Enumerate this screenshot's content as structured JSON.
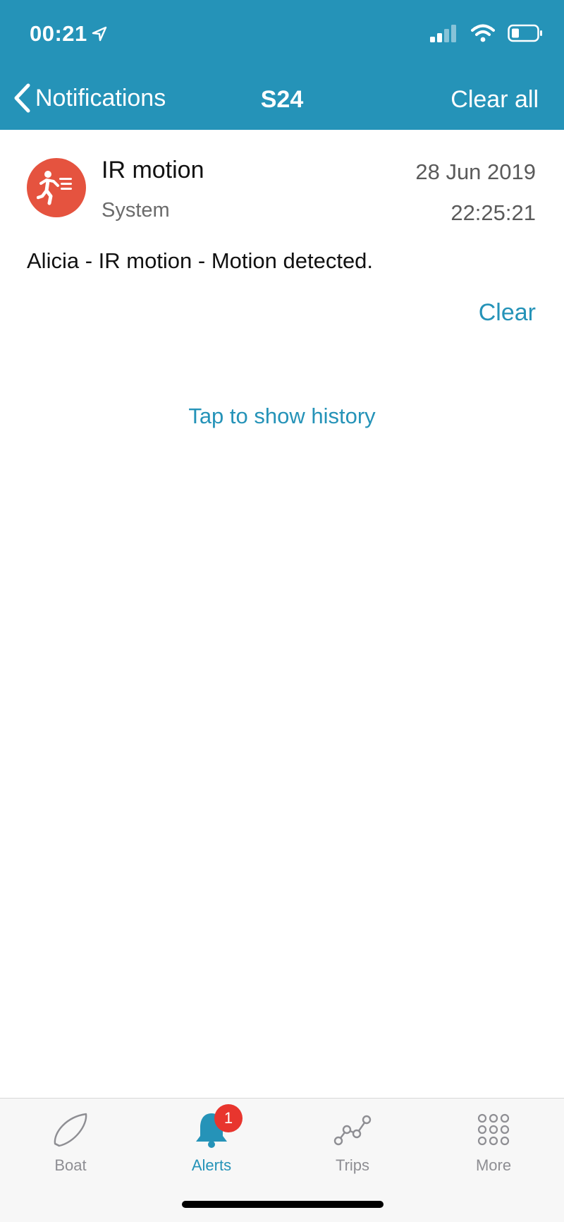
{
  "status_bar": {
    "time": "00:21"
  },
  "nav": {
    "back_label": "Notifications",
    "title": "S24",
    "clear_all_label": "Clear all"
  },
  "notification": {
    "icon": "running-person-icon",
    "title": "IR motion",
    "category": "System",
    "date": "28 Jun 2019",
    "time": "22:25:21",
    "message": "Alicia - IR motion - Motion detected.",
    "clear_label": "Clear"
  },
  "history_link": "Tap to show history",
  "tabs": [
    {
      "label": "Boat",
      "icon": "boat-icon",
      "active": false
    },
    {
      "label": "Alerts",
      "icon": "bell-icon",
      "active": true,
      "badge": "1"
    },
    {
      "label": "Trips",
      "icon": "trips-graph-icon",
      "active": false
    },
    {
      "label": "More",
      "icon": "grid-dots-icon",
      "active": false
    }
  ],
  "colors": {
    "accent": "#2593b8",
    "alert_red": "#e5533f",
    "badge_red": "#e8352e",
    "tab_inactive": "#8e8e93"
  }
}
